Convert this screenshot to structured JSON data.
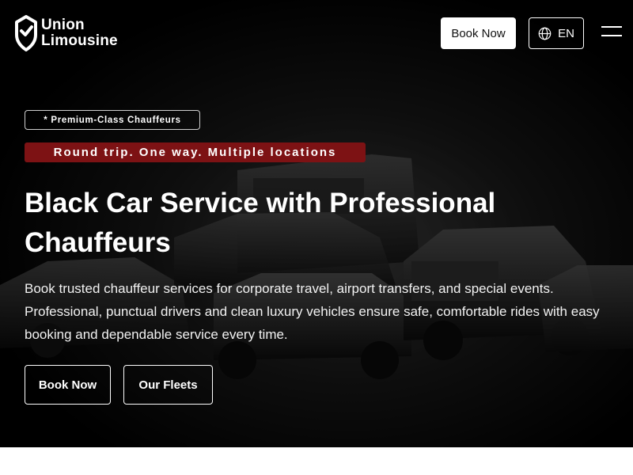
{
  "brand": {
    "name_line1": "Union",
    "name_line2": "Limousine",
    "icon": "shield-check-logo"
  },
  "header": {
    "book_label": "Book Now",
    "lang_label": "EN",
    "lang_icon": "globe-icon",
    "menu_icon": "hamburger-icon"
  },
  "hero": {
    "badge": "* Premium-Class Chauffeurs",
    "tagline": "Round trip. One way. Multiple locations",
    "title": "Black Car Service with Professional Chauffeurs",
    "description": "Book trusted chauffeur services for corporate travel, airport transfers, and special events. Professional, punctual drivers and clean luxury vehicles ensure safe, comfortable rides with easy booking and dependable service every time.",
    "cta_primary": "Book Now",
    "cta_secondary": "Our Fleets"
  },
  "colors": {
    "hero_bg": "#000000",
    "tagline_bg": "#7d1214",
    "text": "#ffffff"
  }
}
